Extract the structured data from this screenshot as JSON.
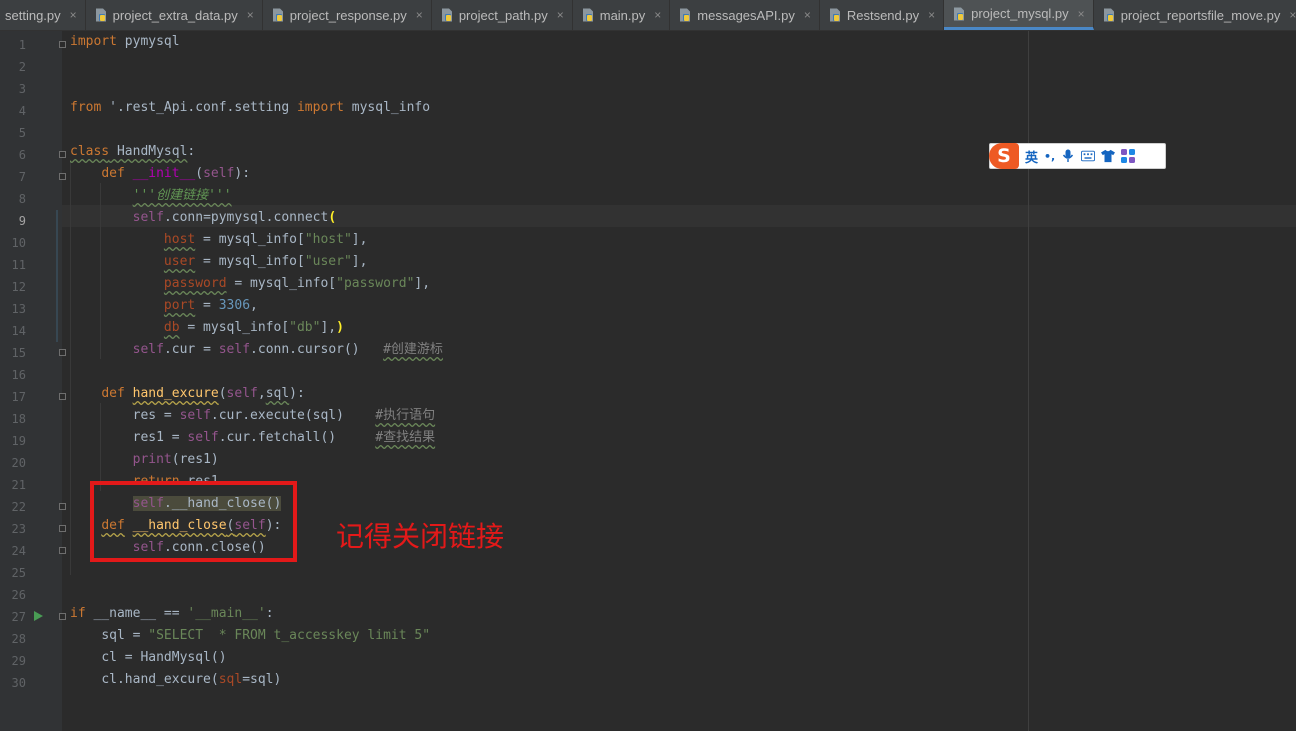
{
  "tabs": [
    {
      "label": "setting.py",
      "active": false,
      "icon": "python-file-icon",
      "truncated_left": true
    },
    {
      "label": "project_extra_data.py",
      "active": false,
      "icon": "python-file-icon"
    },
    {
      "label": "project_response.py",
      "active": false,
      "icon": "python-file-icon"
    },
    {
      "label": "project_path.py",
      "active": false,
      "icon": "python-file-icon"
    },
    {
      "label": "main.py",
      "active": false,
      "icon": "python-file-icon"
    },
    {
      "label": "messagesAPI.py",
      "active": false,
      "icon": "python-file-icon"
    },
    {
      "label": "Restsend.py",
      "active": false,
      "icon": "python-file-icon"
    },
    {
      "label": "project_mysql.py",
      "active": true,
      "icon": "python-file-icon"
    },
    {
      "label": "project_reportsfile_move.py",
      "active": false,
      "icon": "python-file-icon"
    }
  ],
  "close_glyph": "×",
  "line_numbers": [
    "1",
    "2",
    "3",
    "4",
    "5",
    "6",
    "7",
    "8",
    "9",
    "10",
    "11",
    "12",
    "13",
    "14",
    "15",
    "16",
    "17",
    "18",
    "19",
    "20",
    "21",
    "22",
    "23",
    "24",
    "25",
    "26",
    "27",
    "28",
    "29",
    "30"
  ],
  "current_line": "9",
  "code": {
    "l1_kw": "import",
    "l1_mod": " pymysql",
    "l4_kw": "from",
    "l4_rest": " '.rest_Api.conf.setting ",
    "l4_kw2": "import",
    "l4_name": " mysql_info",
    "l6_kw": "class",
    "l6_name": " HandMysql",
    "l6_colon": ":",
    "l7_def": "def",
    "l7_name": "__init__",
    "l7_open": "(",
    "l7_self": "self",
    "l7_close": "):",
    "l8_doc": "'''创建链接'''",
    "l9_self": "self",
    "l9_rest": ".conn=pymysql.connect",
    "l9_brace": "(",
    "l10_param": "host",
    "l10_mid": " = mysql_info[",
    "l10_str": "\"host\"",
    "l10_end": "],",
    "l11_param": "user",
    "l11_mid": " = mysql_info[",
    "l11_str": "\"user\"",
    "l11_end": "],",
    "l12_param": "password",
    "l12_mid": " = mysql_info[",
    "l12_str": "\"password\"",
    "l12_end": "],",
    "l13_param": "port",
    "l13_mid": " = ",
    "l13_num": "3306",
    "l13_end": ",",
    "l14_param": "db",
    "l14_mid": " = mysql_info[",
    "l14_str": "\"db\"",
    "l14_end": "],",
    "l14_brace": ")",
    "l15_self1": "self",
    "l15_mid": ".cur = ",
    "l15_self2": "self",
    "l15_rest": ".conn.cursor()   ",
    "l15_cm": "#创建游标",
    "l17_def": "def",
    "l17_name": "hand_excure",
    "l17_open": "(",
    "l17_self": "self",
    "l17_sep": ",",
    "l17_sql": "sql",
    "l17_close": "):",
    "l18_a": "res = ",
    "l18_self": "self",
    "l18_b": ".cur.execute(sql)    ",
    "l18_cm": "#执行语句",
    "l19_a": "res1 = ",
    "l19_self": "self",
    "l19_b": ".cur.fetchall()     ",
    "l19_cm": "#查找结果",
    "l20_fn": "print",
    "l20_rest": "(res1)",
    "l21_kw": "return",
    "l21_rest": " res1",
    "l22_self": "self",
    "l22_rest": ".__hand_close()",
    "l23_def": "def",
    "l23_name": "__hand_close",
    "l23_open": "(",
    "l23_self": "self",
    "l23_close": "):",
    "l24_self": "self",
    "l24_rest": ".conn.close()",
    "l27_kw": "if",
    "l27_a": " __name__ == ",
    "l27_str": "'__main__'",
    "l27_colon": ":",
    "l28_a": "sql = ",
    "l28_str": "\"SELECT  * FROM t_accesskey limit 5\"",
    "l29_a": "cl = HandMysql()",
    "l30_a": "cl.hand_excure(",
    "l30_param": "sql",
    "l30_b": "=sql)"
  },
  "annotation": "记得关闭链接",
  "ime": {
    "logo": "S",
    "lang": "英",
    "punct": "•,"
  },
  "colors": {
    "annotation_red": "#e31919",
    "active_tab_underline": "#4a88c7",
    "ime_brand": "#ee5a24"
  }
}
